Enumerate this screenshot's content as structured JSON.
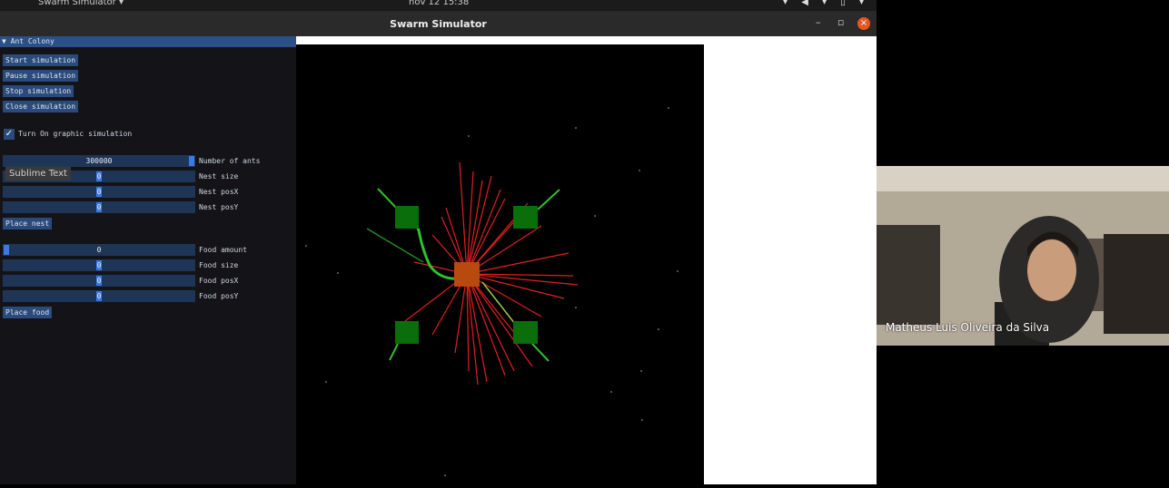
{
  "topbar": {
    "app_name": "Swarm Simulator ▾",
    "clock": "nov 12  15:38",
    "tray": "▾ ◀ ▾ ▯ ▾"
  },
  "window": {
    "title": "Swarm Simulator",
    "minimize": "–",
    "maximize": "▫",
    "close": "×"
  },
  "panel": {
    "header": "▼ Ant Colony",
    "buttons": {
      "start": "Start simulation",
      "pause": "Pause simulation",
      "stop": "Stop simulation",
      "close": "Close simulation"
    },
    "graphic_toggle": {
      "label": "Turn On graphic simulation",
      "checked": true,
      "mark": "✓"
    },
    "nest": {
      "ants_value": "300000",
      "ants_label": "Number of ants",
      "size_value": "0",
      "size_label": "Nest size",
      "posx_value": "0",
      "posx_label": "Nest posX",
      "posy_value": "0",
      "posy_label": "Nest posY",
      "place_button": "Place nest"
    },
    "food": {
      "amount_value": "0",
      "amount_label": "Food amount",
      "size_value": "0",
      "size_label": "Food size",
      "posx_value": "0",
      "posx_label": "Food posX",
      "posy_value": "0",
      "posy_label": "Food posY",
      "place_button": "Place food"
    },
    "tooltip": "Sublime Text"
  },
  "webcam": {
    "participant_name": "Matheus Luis Oliveira da Silva"
  },
  "colors": {
    "accent": "#294a7a",
    "header": "#2b4f87",
    "nest": "#b84a10",
    "food": "#0a6e0a",
    "trail_red": "#e02020",
    "trail_green": "#30c030"
  }
}
